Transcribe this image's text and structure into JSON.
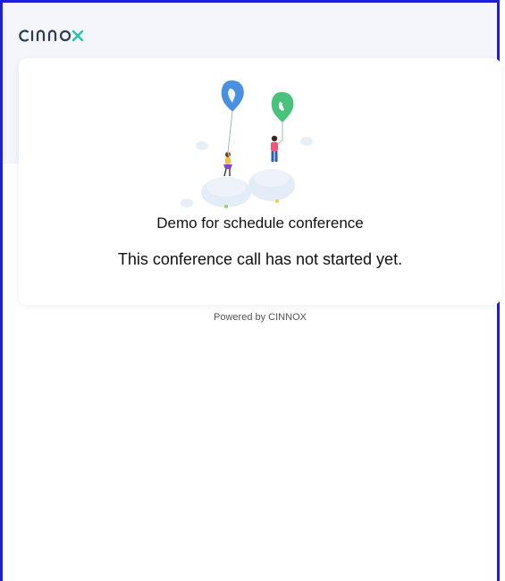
{
  "brand": {
    "logo_text": "cinnox",
    "accent": "#1fc4a6",
    "logo_color": "#2b3a55"
  },
  "event": {
    "title": "Demo for schedule conference",
    "status_message": "This conference call has not started yet."
  },
  "footer": {
    "powered_by": "Powered by CINNOX"
  },
  "illustration": {
    "icon": "balloon-people-illustration",
    "balloon_colors": [
      "#4a90e2",
      "#49c27c"
    ]
  }
}
